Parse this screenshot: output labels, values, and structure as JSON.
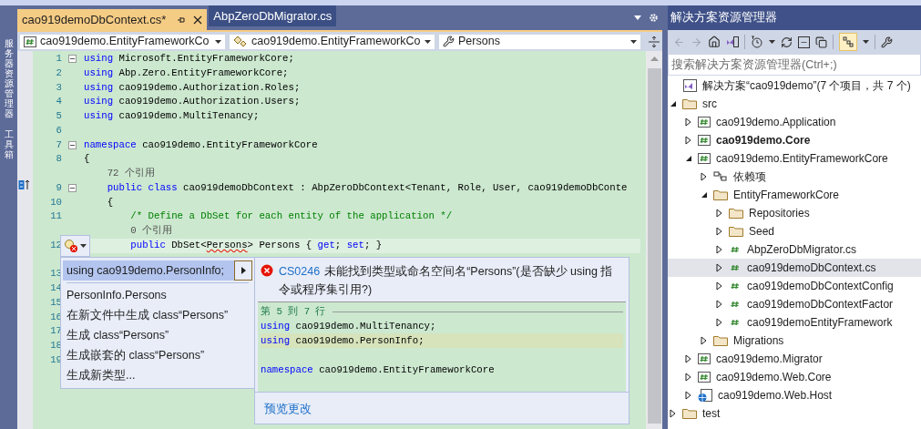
{
  "side_strip": [
    {
      "label": "服务器资源管理器"
    },
    {
      "label": "工具箱"
    }
  ],
  "tabs": [
    {
      "label": "cao919demoDbContext.cs*",
      "selected": true
    },
    {
      "label": "AbpZeroDbMigrator.cs",
      "selected": false
    }
  ],
  "nav_bar": {
    "project": "cao919demo.EntityFrameworkCo",
    "type": "cao919demo.EntityFrameworkCo",
    "member": "Persons"
  },
  "code_lines": [
    {
      "kind": "code",
      "number": "1",
      "fold": true,
      "segments": [
        {
          "kind": "keyword",
          "text": "using"
        },
        {
          "kind": "plain",
          "text": " Microsoft.EntityFrameworkCore;"
        }
      ]
    },
    {
      "kind": "code",
      "number": "2",
      "fold": false,
      "segments": [
        {
          "kind": "keyword",
          "text": "using"
        },
        {
          "kind": "plain",
          "text": " Abp.Zero.EntityFrameworkCore;"
        }
      ]
    },
    {
      "kind": "code",
      "number": "3",
      "fold": false,
      "segments": [
        {
          "kind": "keyword",
          "text": "using"
        },
        {
          "kind": "plain",
          "text": " cao919demo.Authorization.Roles;"
        }
      ]
    },
    {
      "kind": "code",
      "number": "4",
      "fold": false,
      "segments": [
        {
          "kind": "keyword",
          "text": "using"
        },
        {
          "kind": "plain",
          "text": " cao919demo.Authorization.Users;"
        }
      ]
    },
    {
      "kind": "code",
      "number": "5",
      "fold": false,
      "segments": [
        {
          "kind": "keyword",
          "text": "using"
        },
        {
          "kind": "plain",
          "text": " cao919demo.MultiTenancy;"
        }
      ]
    },
    {
      "kind": "code",
      "number": "6",
      "fold": false
    },
    {
      "kind": "code",
      "number": "7",
      "fold": true,
      "segments": [
        {
          "kind": "keyword",
          "text": "namespace"
        },
        {
          "kind": "plain",
          "text": " cao919demo.EntityFrameworkCore"
        }
      ]
    },
    {
      "kind": "code",
      "number": "8",
      "fold": false,
      "segments": [
        {
          "kind": "plain",
          "text": "{"
        }
      ]
    },
    {
      "kind": "lens",
      "segments": [
        {
          "kind": "lens",
          "text": "    72 个引用"
        }
      ]
    },
    {
      "kind": "code",
      "number": "9",
      "fold": true,
      "segments": [
        {
          "kind": "keyword",
          "text": "    public class"
        },
        {
          "kind": "plain",
          "text": " cao919demoDbContext : AbpZeroDbContext<Tenant, Role, User, cao919demoDbConte"
        }
      ]
    },
    {
      "kind": "code",
      "number": "10",
      "fold": false,
      "segments": [
        {
          "kind": "plain",
          "text": "    {"
        }
      ]
    },
    {
      "kind": "code",
      "number": "11",
      "fold": false,
      "segments": [
        {
          "kind": "comment",
          "text": "        /* Define a DbSet for each entity of the application */"
        }
      ]
    },
    {
      "kind": "lens",
      "segments": [
        {
          "kind": "lens",
          "text": "        0 个引用"
        }
      ]
    },
    {
      "kind": "code",
      "number": "12",
      "fold": false,
      "current": true,
      "segments": [
        {
          "kind": "keyword",
          "text": "        public"
        },
        {
          "kind": "plain",
          "text": " DbSet<"
        },
        {
          "kind": "error",
          "text": "Persons"
        },
        {
          "kind": "plain",
          "text": "> Persons { "
        },
        {
          "kind": "keyword",
          "text": "get"
        },
        {
          "kind": "plain",
          "text": "; "
        },
        {
          "kind": "keyword",
          "text": "set"
        },
        {
          "kind": "plain",
          "text": "; }"
        }
      ]
    },
    {
      "kind": "lens"
    },
    {
      "kind": "code",
      "number": "13",
      "fold": false
    },
    {
      "kind": "code",
      "number": "14",
      "fold": false
    },
    {
      "kind": "code",
      "number": "15",
      "fold": false
    },
    {
      "kind": "code",
      "number": "16",
      "fold": false
    },
    {
      "kind": "code",
      "number": "17",
      "fold": false
    },
    {
      "kind": "code",
      "number": "18",
      "fold": false
    },
    {
      "kind": "code",
      "number": "19",
      "fold": false
    }
  ],
  "quick_actions": [
    {
      "label": "using cao919demo.PersonInfo;",
      "selected": true
    },
    {
      "label": "PersonInfo.Persons",
      "selected": false
    },
    {
      "label": "在新文件中生成 class“Persons”",
      "selected": false
    },
    {
      "label": "生成 class“Persons”",
      "selected": false
    },
    {
      "label": "生成嵌套的 class“Persons”",
      "selected": false
    },
    {
      "label": "生成新类型...",
      "selected": false
    }
  ],
  "preview": {
    "error_code": "CS0246",
    "message": "未能找到类型或命名空间名“Persons”(是否缺少 using 指令或程序集引用?)",
    "range": "第 5 到 7 行",
    "lines": [
      {
        "added": false,
        "segments": [
          {
            "kind": "keyword",
            "text": "using"
          },
          {
            "kind": "plain",
            "text": " cao919demo.MultiTenancy;"
          }
        ]
      },
      {
        "added": true,
        "segments": [
          {
            "kind": "keyword",
            "text": "using"
          },
          {
            "kind": "plain",
            "text": " cao919demo.PersonInfo;"
          }
        ]
      },
      {
        "added": false
      },
      {
        "added": false,
        "segments": [
          {
            "kind": "keyword",
            "text": "namespace"
          },
          {
            "kind": "plain",
            "text": " cao919demo.EntityFrameworkCore"
          }
        ]
      }
    ],
    "link": "预览更改"
  },
  "solution_explorer": {
    "title": "解决方案资源管理器",
    "search_placeholder": "搜索解决方案资源管理器(Ctrl+;)",
    "tree": [
      {
        "label": "解决方案“cao919demo”(7 个项目，共 7 个)",
        "kind": "solution",
        "selected": false,
        "children": [
          {
            "label": "src",
            "kind": "folder",
            "expanded": true,
            "selected": false,
            "children": [
              {
                "label": "cao919demo.Application",
                "kind": "project",
                "bold": false,
                "expanded": false,
                "selected": false
              },
              {
                "label": "cao919demo.Core",
                "kind": "project",
                "bold": true,
                "expanded": false,
                "selected": false
              },
              {
                "label": "cao919demo.EntityFrameworkCore",
                "kind": "project",
                "bold": false,
                "expanded": true,
                "selected": false,
                "children": [
                  {
                    "label": "依赖项",
                    "kind": "dependencies",
                    "expanded": false,
                    "selected": false
                  },
                  {
                    "label": "EntityFrameworkCore",
                    "kind": "folder",
                    "expanded": true,
                    "selected": false,
                    "children": [
                      {
                        "label": "Repositories",
                        "kind": "folder",
                        "expanded": false,
                        "selected": false
                      },
                      {
                        "label": "Seed",
                        "kind": "folder",
                        "expanded": false,
                        "selected": false
                      },
                      {
                        "label": "AbpZeroDbMigrator.cs",
                        "kind": "file",
                        "expanded": false,
                        "selected": false
                      },
                      {
                        "label": "cao919demoDbContext.cs",
                        "kind": "file",
                        "expanded": false,
                        "selected": true
                      },
                      {
                        "label": "cao919demoDbContextConfig",
                        "kind": "file",
                        "expanded": false,
                        "selected": false
                      },
                      {
                        "label": "cao919demoDbContextFactor",
                        "kind": "file",
                        "expanded": false,
                        "selected": false
                      },
                      {
                        "label": "cao919demoEntityFramework",
                        "kind": "file",
                        "expanded": false,
                        "selected": false
                      }
                    ]
                  },
                  {
                    "label": "Migrations",
                    "kind": "folder",
                    "expanded": false,
                    "selected": false
                  }
                ]
              },
              {
                "label": "cao919demo.Migrator",
                "kind": "project",
                "bold": false,
                "expanded": false,
                "selected": false
              },
              {
                "label": "cao919demo.Web.Core",
                "kind": "project",
                "bold": false,
                "expanded": false,
                "selected": false
              },
              {
                "label": "cao919demo.Web.Host",
                "kind": "web-project",
                "bold": false,
                "expanded": false,
                "selected": false
              }
            ]
          },
          {
            "label": "test",
            "kind": "folder",
            "expanded": false,
            "selected": false
          }
        ]
      }
    ]
  }
}
